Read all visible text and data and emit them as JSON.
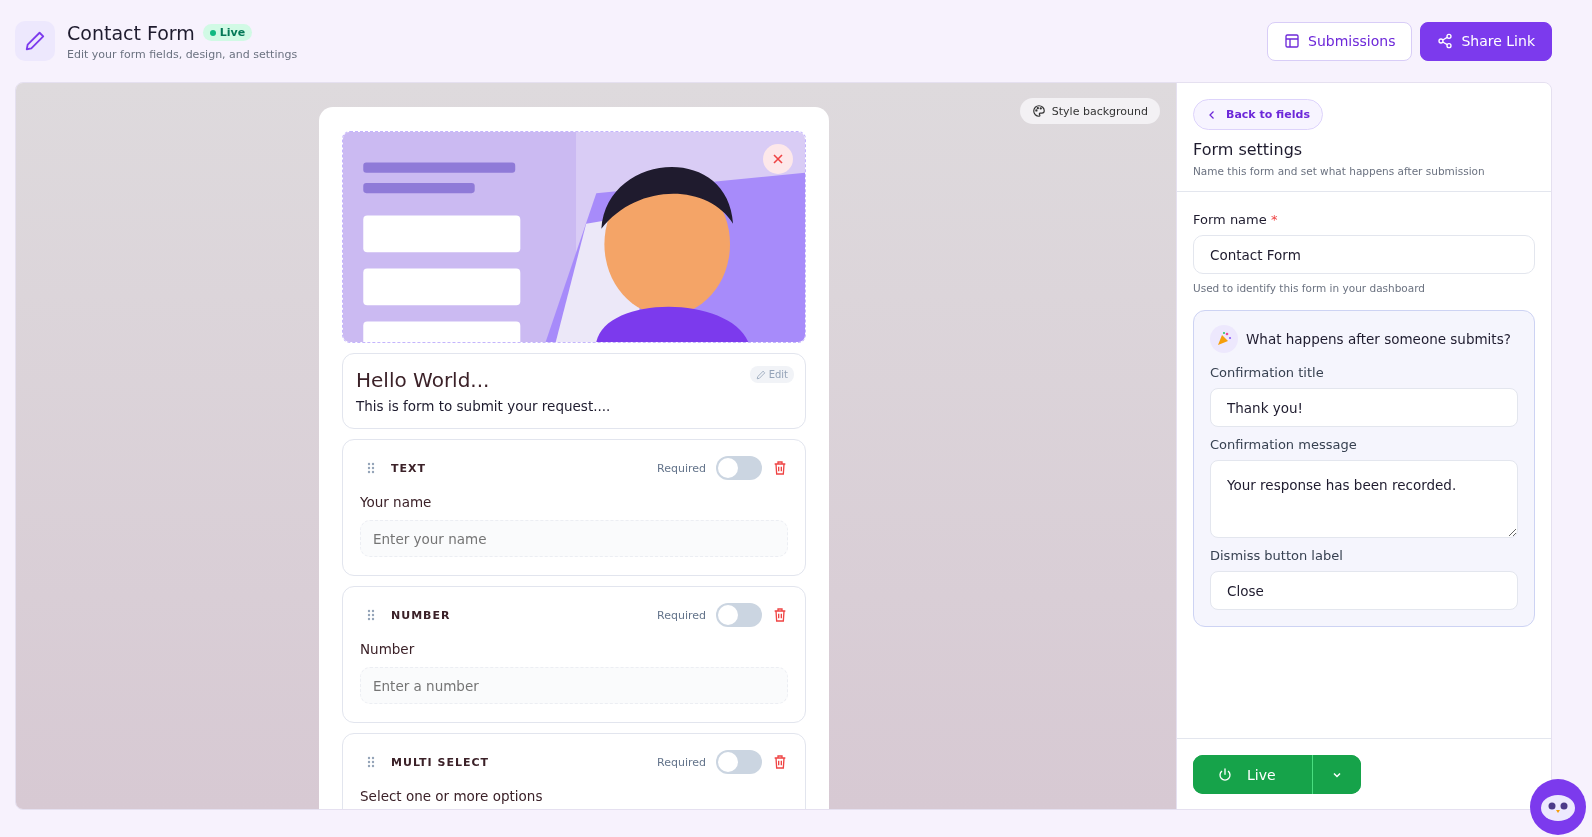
{
  "header": {
    "title": "Contact Form",
    "status": "Live",
    "subtitle": "Edit your form fields, design, and settings",
    "buttons": [
      {
        "label": "Submissions",
        "kind": "outline"
      },
      {
        "label": "Share Link",
        "kind": "primary"
      }
    ]
  },
  "canvas": {
    "style_button": "Style background",
    "intro": {
      "title": "Hello World...",
      "description": "This is form to submit your request....",
      "edit": "Edit"
    },
    "fields": [
      {
        "type": "TEXT",
        "required_label": "Required",
        "required": false,
        "label": "Your name",
        "placeholder": "Enter your name"
      },
      {
        "type": "NUMBER",
        "required_label": "Required",
        "required": false,
        "label": "Number",
        "placeholder": "Enter a number"
      },
      {
        "type": "MULTI SELECT",
        "required_label": "Required",
        "required": false,
        "label": "Select one or more options"
      }
    ]
  },
  "settings": {
    "back": "Back to fields",
    "title": "Form settings",
    "subtitle": "Name this form and set what happens after submission",
    "form_name": {
      "label": "Form name",
      "required_mark": "*",
      "value": "Contact Form",
      "hint": "Used to identify this form in your dashboard"
    },
    "after": {
      "title": "What happens after someone submits?",
      "confirmation_title": {
        "label": "Confirmation title",
        "value": "Thank you!"
      },
      "confirmation_message": {
        "label": "Confirmation message",
        "value": "Your response has been recorded."
      },
      "dismiss": {
        "label": "Dismiss button label",
        "value": "Close"
      }
    },
    "live_button": "Live"
  }
}
